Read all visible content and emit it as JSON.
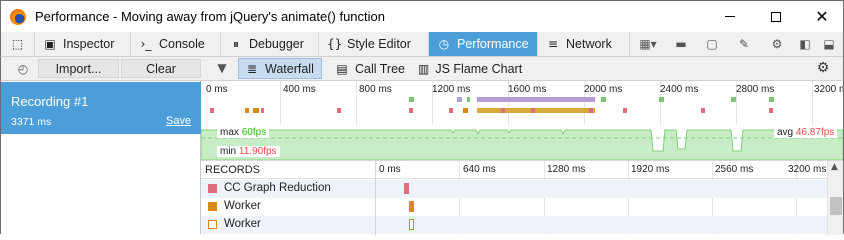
{
  "window": {
    "title": "Performance - Moving away from jQuery's animate() function",
    "minimize_icon": "minimize-icon",
    "maximize_icon": "maximize-icon",
    "close_glyph": "✕"
  },
  "toolbox": {
    "tabs": [
      {
        "label": "",
        "icon": "element-picker-icon"
      },
      {
        "label": "Inspector",
        "icon": "inspector-icon"
      },
      {
        "label": "Console",
        "icon": "console-icon"
      },
      {
        "label": "Debugger",
        "icon": "debugger-icon"
      },
      {
        "label": "Style Editor",
        "icon": "style-editor-icon"
      },
      {
        "label": "Performance",
        "icon": "performance-icon",
        "active": true
      },
      {
        "label": "Network",
        "icon": "network-icon"
      }
    ],
    "right_icons": [
      "frame-select-icon",
      "split-console-icon",
      "responsive-design-icon",
      "eyedropper-icon",
      "settings-gear-icon",
      "dock-side-icon",
      "dock-bottom-icon",
      "close-toolbox-icon"
    ],
    "accent_color": "#4c9ed9"
  },
  "subtoolbar": {
    "record_icon": "stopwatch-icon",
    "import_label": "Import...",
    "clear_label": "Clear",
    "filter_icon": "filter-icon",
    "views": [
      {
        "label": "Waterfall",
        "icon": "waterfall-icon",
        "active": true
      },
      {
        "label": "Call Tree",
        "icon": "call-tree-icon"
      },
      {
        "label": "JS Flame Chart",
        "icon": "flame-chart-icon"
      }
    ],
    "options_icon": "gear-icon"
  },
  "recordings": [
    {
      "name": "Recording #1",
      "duration": "3371 ms",
      "save_label": "Save",
      "selected": true
    }
  ],
  "overview": {
    "ruler_labels": [
      "0 ms",
      "400 ms",
      "800 ms",
      "1200 ms",
      "1600 ms",
      "2000 ms",
      "2400 ms",
      "2800 ms",
      "3200 ms"
    ],
    "fps": {
      "max_label": "max",
      "max_value": "60",
      "min_label": "min",
      "min_value": "11.90",
      "avg_label": "avg",
      "avg_value": "46.87",
      "unit": "fps",
      "max_color": "#2cbb0f",
      "min_color": "#e64b4b",
      "avg_color": "#e64b4b"
    }
  },
  "waterfall": {
    "header": "RECORDS",
    "ruler_labels": [
      "0 ms",
      "640 ms",
      "1280 ms",
      "1920 ms",
      "2560 ms",
      "3200 ms"
    ],
    "rows": [
      {
        "label": "CC Graph Reduction",
        "color": "#e06c7c",
        "hollow": false
      },
      {
        "label": "Worker",
        "color": "#d98a15",
        "hollow": false
      },
      {
        "label": "Worker",
        "color": "#d98a15",
        "hollow": true
      }
    ]
  }
}
